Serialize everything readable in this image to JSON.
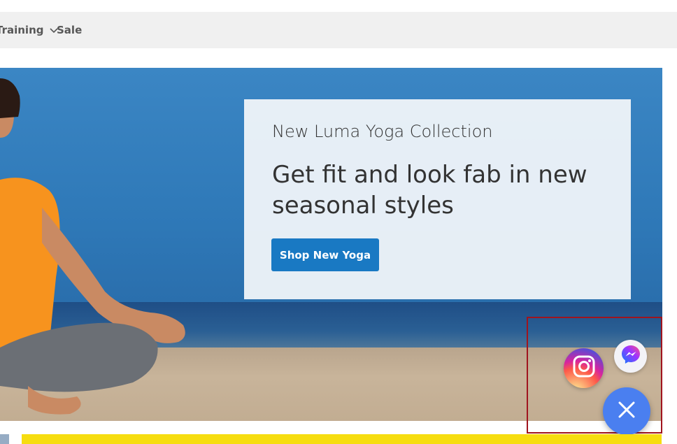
{
  "nav": {
    "items": [
      {
        "label": "Training"
      },
      {
        "label": "Sale"
      }
    ]
  },
  "hero": {
    "subtitle": "New Luma Yoga Collection",
    "title": "Get fit and look fab in new seasonal styles",
    "cta_label": "Shop New Yoga"
  },
  "contact_widget": {
    "buttons": [
      {
        "icon": "instagram-icon"
      },
      {
        "icon": "messenger-icon"
      },
      {
        "icon": "close-icon"
      }
    ]
  },
  "colors": {
    "nav_background": "#f0f0f0",
    "nav_text": "#575757",
    "cta_background": "#1979c3",
    "focus_box": "#a0141e",
    "close_fab": "#4a7ff0",
    "bottom_bar": "#f6dd10"
  }
}
